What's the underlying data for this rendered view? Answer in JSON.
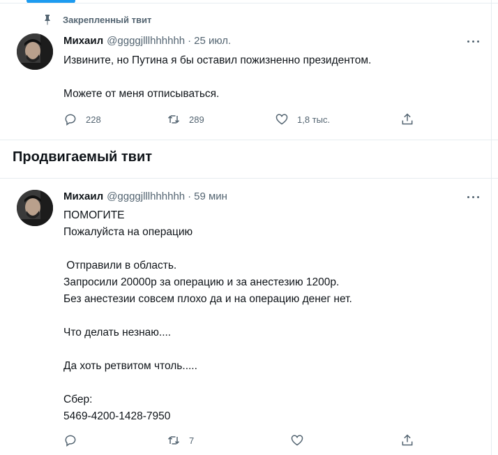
{
  "pinned_label": "Закрепленный твит",
  "section_title": "Продвигаемый твит",
  "tweets": [
    {
      "name": "Михаил",
      "handle": "@ggggjlllhhhhhh",
      "separator": "·",
      "time": "25 июл.",
      "text": "Извините, но Путина я бы оставил пожизненно президентом.\n\nМожете от меня отписываться.",
      "replies": "228",
      "retweets": "289",
      "likes": "1,8 тыс."
    },
    {
      "name": "Михаил",
      "handle": "@ggggjlllhhhhhh",
      "separator": "·",
      "time": "59 мин",
      "text": "ПОМОГИТЕ\nПожалуйста на операцию\n\n Отправили в область.\nЗапросили 20000р за операцию и за анестезию 1200р.\nБез анестезии совсем плохо да и на операцию денег нет.\n\nЧто делать незнаю....\n\nДа хоть ретвитом чтоль.....\n\nСбер:\n5469-4200-1428-7950",
      "replies": "",
      "retweets": "7",
      "likes": ""
    }
  ],
  "icons": {
    "pin": "pin-icon",
    "more": "more-icon",
    "reply": "reply-icon",
    "retweet": "retweet-icon",
    "like": "heart-icon",
    "share": "share-icon"
  },
  "colors": {
    "accent": "#1d9bf0",
    "secondary_text": "#536471",
    "divider": "#e6ecf0"
  }
}
